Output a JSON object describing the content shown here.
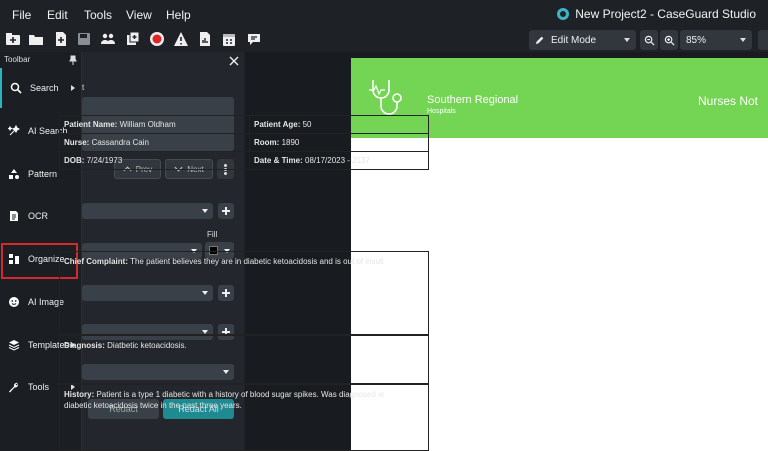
{
  "menu": [
    "File",
    "Edit",
    "Tools",
    "View",
    "Help"
  ],
  "app_title": "New Project2 - CaseGuard Studio",
  "toolbar_right": {
    "mode": "Edit Mode",
    "zoom": "85%"
  },
  "side_panel": {
    "title": "Toolbar",
    "items": [
      {
        "label": "Search",
        "icon": "search-icon",
        "has_arrow": true
      },
      {
        "label": "AI Search",
        "icon": "ai-search-icon",
        "has_arrow": false
      },
      {
        "label": "Pattern",
        "icon": "pattern-icon",
        "has_arrow": false
      },
      {
        "label": "OCR",
        "icon": "ocr-icon",
        "has_arrow": false
      },
      {
        "label": "Organize",
        "icon": "organize-icon",
        "has_arrow": false
      },
      {
        "label": "AI Image",
        "icon": "ai-image-icon",
        "has_arrow": false
      },
      {
        "label": "Templates",
        "icon": "templates-icon",
        "has_arrow": true
      },
      {
        "label": "Tools",
        "icon": "tools-icon",
        "has_arrow": true
      }
    ],
    "highlighted": "Organize"
  },
  "search_panel": {
    "peek_text": "t",
    "prev_label": "Prev",
    "next_label": "Next",
    "fill_label": "Fill",
    "redact_label": "Redact",
    "redact_all_label": "Redact All"
  },
  "document": {
    "org_name": "Southern Regional",
    "org_sub": "Hospitals",
    "title": "Nurses Not",
    "fields": {
      "patient_name_label": "Patient Name:",
      "patient_name": "William Oldham",
      "patient_age_label": "Patient Age:",
      "patient_age": "50",
      "nurse_label": "Nurse:",
      "nurse": "Cassandra Cain",
      "room_label": "Room:",
      "room": "1890",
      "dob_label": "DOB:",
      "dob": "7/24/1973",
      "datetime_label": "Date & Time:",
      "datetime": "08/17/2023 - 2137"
    },
    "chief_complaint_label": "Chief Complaint:",
    "chief_complaint": "The patient believes they are in diabetic ketoacidosis and is out of insuli",
    "diagnosis_label": "Diagnosis:",
    "diagnosis": "Diatbetic ketoacidosis.",
    "history_label": "History:",
    "history_line1": "Patient is a type 1 diabetic with a history of blood sugar spikes. Was diagnosed w",
    "history_line2": "diabetic ketoacidosis twice in the past three years."
  },
  "colors": {
    "accent": "#2bb3c0",
    "header_green": "#74d453",
    "highlight_red": "#d12b2b"
  }
}
